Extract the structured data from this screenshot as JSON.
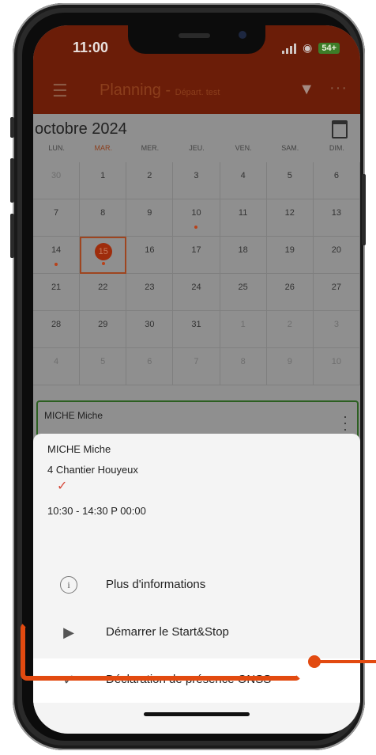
{
  "status_bar": {
    "time": "11:00",
    "battery": "54+"
  },
  "app_bar": {
    "menu_icon": "hamburger-icon",
    "title": "Planning - ",
    "subtitle": "Départ. test",
    "filter_icon": "filter-icon",
    "more_icon": "more-horizontal-icon"
  },
  "calendar": {
    "month": "octobre 2024",
    "weekdays": [
      "LUN.",
      "MAR.",
      "MER.",
      "JEU.",
      "VEN.",
      "SAM.",
      "DIM."
    ],
    "today_weekday_index": 1,
    "days": [
      [
        "30",
        "1",
        "2",
        "3",
        "4",
        "5",
        "6"
      ],
      [
        "7",
        "8",
        "9",
        "10",
        "11",
        "12",
        "13"
      ],
      [
        "14",
        "15",
        "16",
        "17",
        "18",
        "19",
        "20"
      ],
      [
        "21",
        "22",
        "23",
        "24",
        "25",
        "26",
        "27"
      ],
      [
        "28",
        "29",
        "30",
        "31",
        "1",
        "2",
        "3"
      ],
      [
        "4",
        "5",
        "6",
        "7",
        "8",
        "9",
        "10"
      ]
    ],
    "selected_day": "15",
    "days_with_events": [
      "10",
      "14",
      "15"
    ]
  },
  "event_card": {
    "employee": "MICHE Miche"
  },
  "detail_sheet": {
    "employee": "MICHE Miche",
    "site": "4 Chantier Houyeux",
    "time_range": "10:30 - 14:30 P 00:00",
    "actions": [
      {
        "label": "Plus d'informations",
        "icon": "info-icon"
      },
      {
        "label": "Démarrer le Start&Stop",
        "icon": "play-icon"
      },
      {
        "label": "Déclaration de présence ONSS",
        "icon": "check-circle-icon"
      }
    ]
  },
  "colors": {
    "header": "#6b1d08",
    "accent": "#e24a10",
    "event_border": "#2c5f21"
  }
}
